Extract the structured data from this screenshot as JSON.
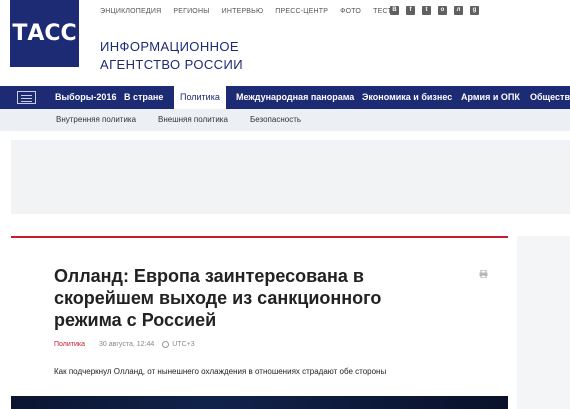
{
  "header": {
    "logo_text": "ТАСС",
    "agency_line1": "ИНФОРМАЦИОННОЕ",
    "agency_line2": "АГЕНТСТВО РОССИИ",
    "top_links": [
      "ЭНЦИКЛОПЕДИЯ",
      "РЕГИОНЫ",
      "ИНТЕРВЬЮ",
      "ПРЕСС-ЦЕНТР",
      "ФОТО",
      "ТЕСТЫ"
    ],
    "social_icons": [
      "vk-icon",
      "facebook-icon",
      "twitter-icon",
      "odnoklassniki-icon",
      "livejournal-icon",
      "google-plus-icon"
    ]
  },
  "mainnav": {
    "items": [
      "Выборы-2016",
      "В стране",
      "Политика",
      "Международная панорама",
      "Экономика и бизнес",
      "Армия и ОПК",
      "Общество"
    ],
    "active": "Политика"
  },
  "subnav": {
    "items": [
      "Внутренняя политика",
      "Внешняя политика",
      "Безопасность"
    ]
  },
  "article": {
    "title_line1": "Олланд: Европа заинтересована в",
    "title_line2": "скорейшем выходе из санкционного",
    "title_line3": "режима с Россией",
    "rubric": "Политика",
    "date": "30 августа, 12:44",
    "timezone": "UTC+3",
    "lead": "Как подчеркнул Олланд, от нынешнего охлаждения в отношениях страдают обе стороны"
  },
  "colors": {
    "brand": "#1d2a74",
    "accent": "#c61c2c"
  }
}
